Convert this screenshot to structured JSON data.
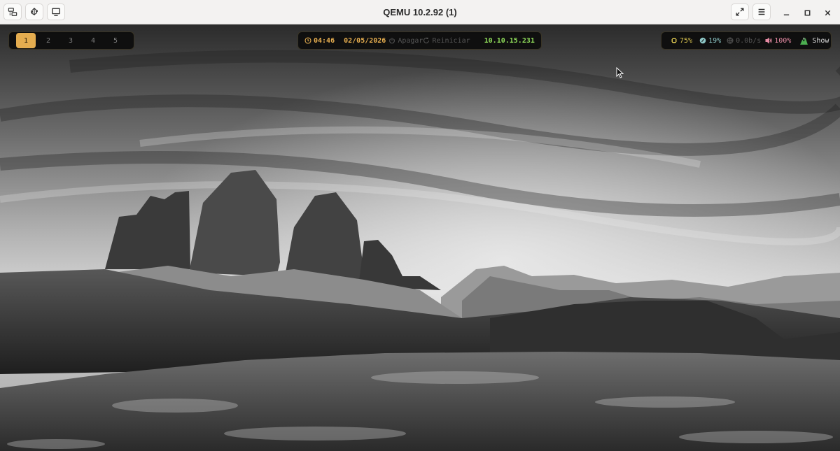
{
  "window": {
    "title": "QEMU 10.2.92 (1)",
    "left_buttons": [
      {
        "icon": "display-settings-icon"
      },
      {
        "icon": "usb-devices-icon"
      },
      {
        "icon": "monitor-icon"
      }
    ],
    "right_buttons": [
      {
        "icon": "fullscreen-icon"
      },
      {
        "icon": "hamburger-menu-icon"
      }
    ],
    "controls": [
      {
        "icon": "minimize-icon"
      },
      {
        "icon": "maximize-icon"
      },
      {
        "icon": "close-icon"
      }
    ]
  },
  "bar": {
    "workspaces": [
      {
        "label": "1",
        "active": true
      },
      {
        "label": "2",
        "active": false
      },
      {
        "label": "3",
        "active": false
      },
      {
        "label": "4",
        "active": false
      },
      {
        "label": "5",
        "active": false
      }
    ],
    "center": {
      "time": "04:46",
      "date": "02/05/2026",
      "shutdown_label": "Apagar",
      "restart_label": "Reiniciar",
      "ip": "10.10.15.231"
    },
    "right": {
      "cpu": "75%",
      "memory": "19%",
      "network": "0.0b/s",
      "volume": "100%",
      "show_label": "Show"
    },
    "colors": {
      "accent": "#e5ad4f",
      "ip": "#8fdc5a",
      "cpu": "#d6c14e",
      "memory": "#8ec7c6",
      "volume": "#e58aa3",
      "muted": "#555555"
    }
  }
}
